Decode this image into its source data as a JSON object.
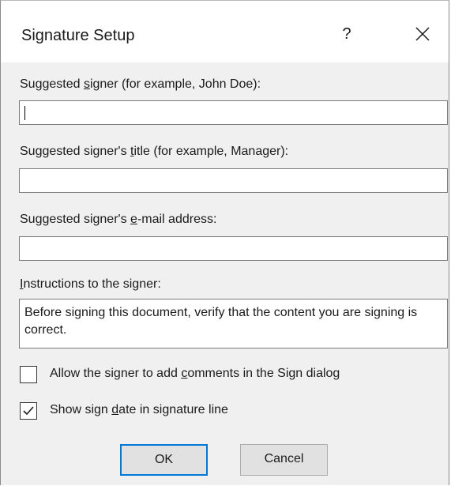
{
  "dialog": {
    "title": "Signature Setup",
    "help_label": "?"
  },
  "fields": {
    "signer": {
      "label_pre": "Suggested ",
      "label_accel": "s",
      "label_post": "igner (for example, John Doe):",
      "value": ""
    },
    "signer_title": {
      "label_pre": "Suggested signer's ",
      "label_accel": "t",
      "label_post": "itle (for example, Manager):",
      "value": ""
    },
    "signer_email": {
      "label_pre": "Suggested signer's ",
      "label_accel": "e",
      "label_post": "-mail address:",
      "value": ""
    },
    "instructions": {
      "label_pre": "",
      "label_accel": "I",
      "label_post": "nstructions to the signer:",
      "value": "Before signing this document, verify that the content you are signing is correct."
    }
  },
  "options": {
    "allow_comments": {
      "label_pre": "Allow the signer to add ",
      "label_accel": "c",
      "label_post": "omments in the Sign dialog",
      "checked": false
    },
    "show_date": {
      "label_pre": "Show sign ",
      "label_accel": "d",
      "label_post": "ate in signature line",
      "checked": true
    }
  },
  "buttons": {
    "ok": "OK",
    "cancel": "Cancel"
  },
  "colors": {
    "default_button_border": "#0078d7",
    "dialog_background": "#f0f0f0",
    "titlebar_background": "#ffffff"
  }
}
